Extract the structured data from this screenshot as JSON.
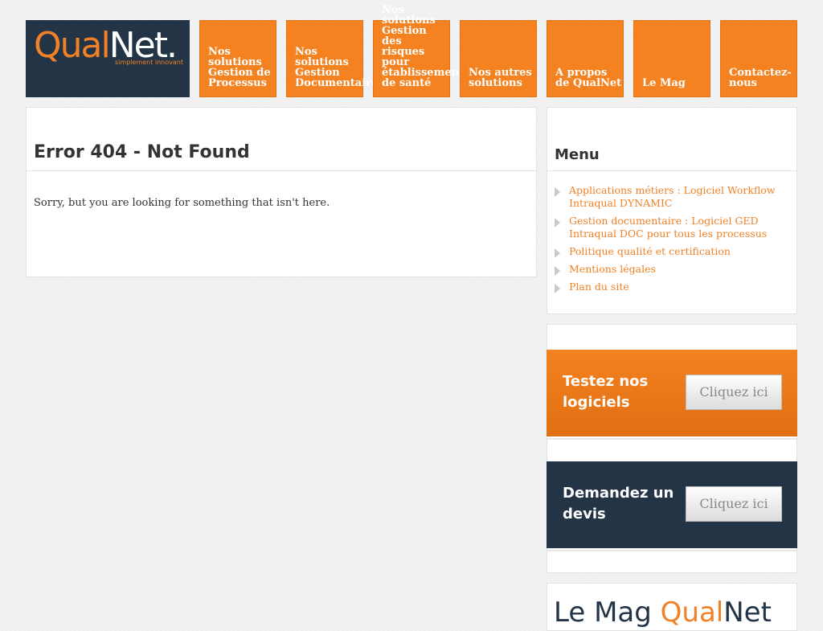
{
  "logo": {
    "part1": "Qual",
    "part2": "Net.",
    "tagline": "simplement innovant"
  },
  "nav": [
    {
      "lines": [
        "Nos",
        "solutions",
        "Gestion de",
        "Processus"
      ]
    },
    {
      "lines": [
        "Nos",
        "solutions",
        "Gestion",
        "Documentaire"
      ]
    },
    {
      "lines": [
        "Nos",
        "solutions",
        "Gestion",
        "des",
        "risques",
        "pour",
        "établissement",
        "de santé"
      ]
    },
    {
      "lines": [
        "Nos autres",
        "solutions"
      ]
    },
    {
      "lines": [
        "A propos",
        "de QualNet"
      ]
    },
    {
      "lines": [
        "Le Mag"
      ]
    },
    {
      "lines": [
        "Contactez-",
        "nous"
      ]
    }
  ],
  "main": {
    "title": "Error 404 - Not Found",
    "message": "Sorry, but you are looking for something that isn't here."
  },
  "menu": {
    "title": "Menu",
    "items": [
      "Applications métiers : Logiciel Workflow Intraqual DYNAMIC",
      "Gestion documentaire : Logiciel GED Intraqual DOC pour tous les processus",
      "Politique qualité et certification",
      "Mentions légales",
      "Plan du site"
    ]
  },
  "cta": {
    "test": {
      "title": "Testez nos logiciels",
      "button": "Cliquez ici"
    },
    "devis": {
      "title": "Demandez un devis",
      "button": "Cliquez ici"
    }
  },
  "mag": {
    "part1": "Le Mag ",
    "part2": "Qual",
    "part3": "Net"
  },
  "colors": {
    "orange": "#f58220",
    "navy": "#243447"
  }
}
